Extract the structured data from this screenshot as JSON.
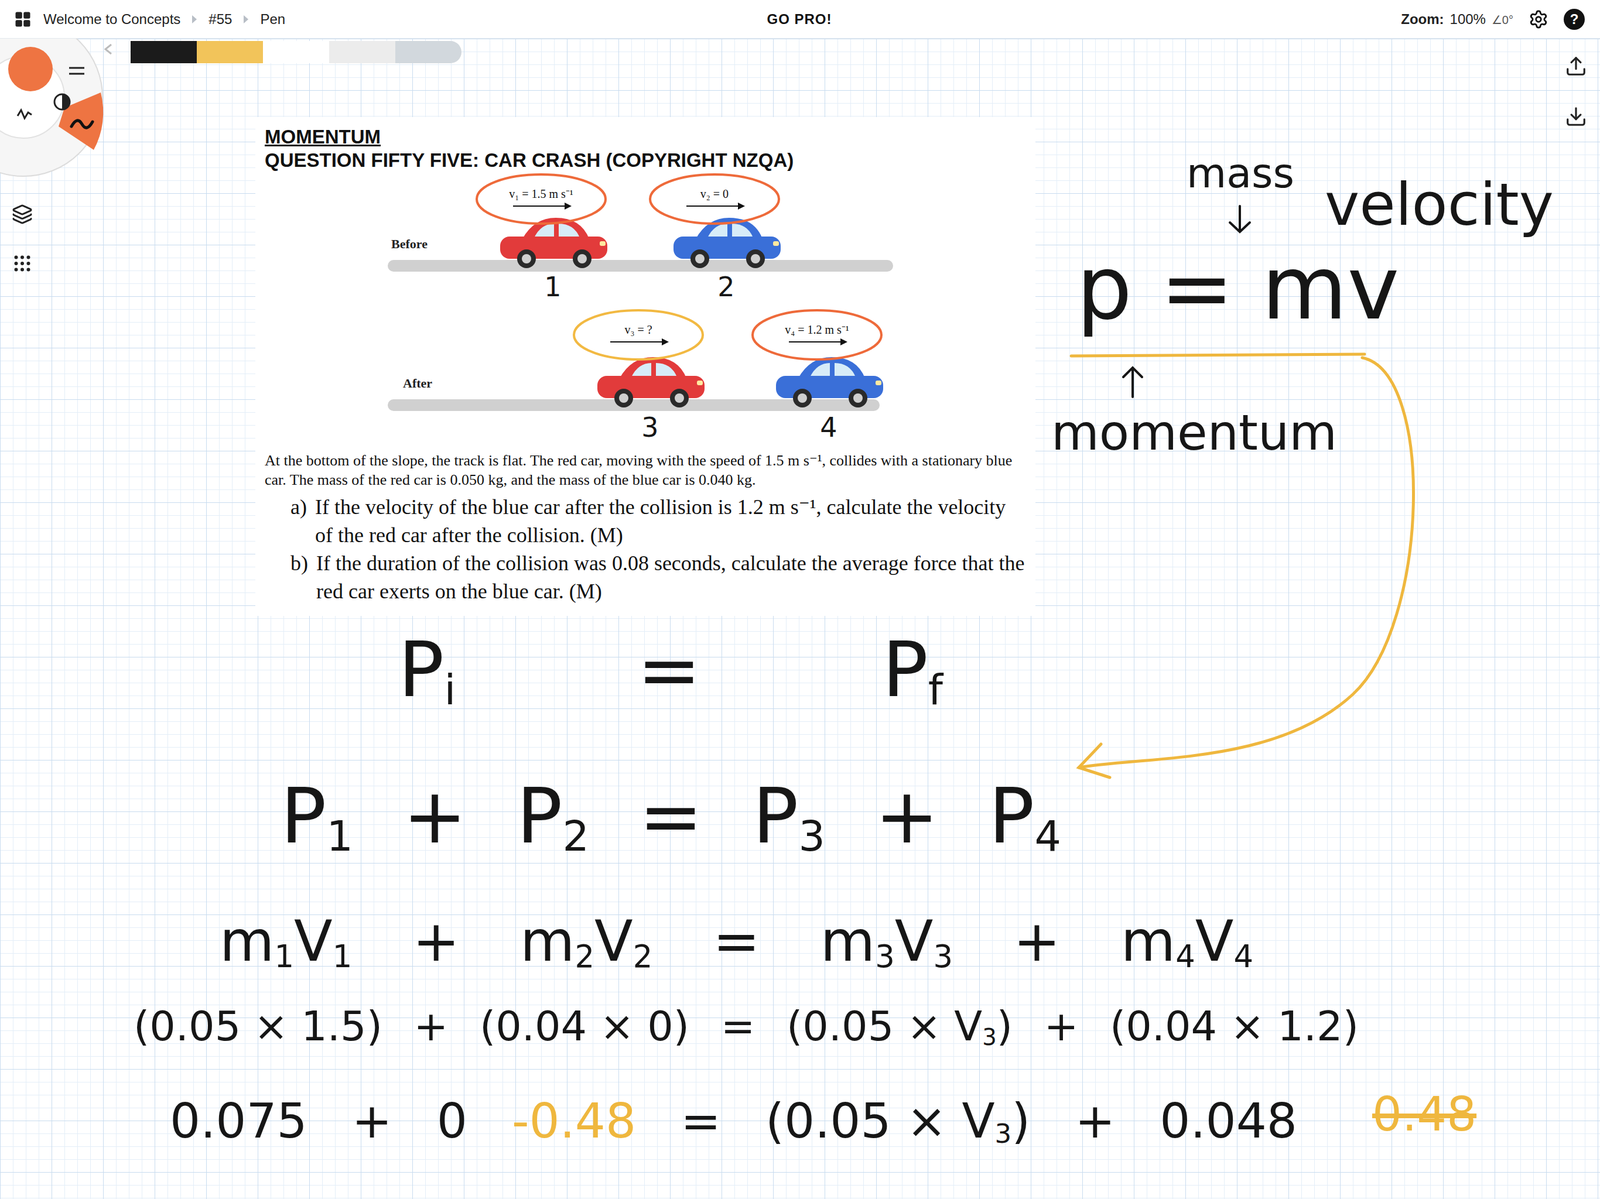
{
  "app_bar": {
    "breadcrumbs": [
      {
        "label": "Welcome to Concepts"
      },
      {
        "label": "#55"
      },
      {
        "label": "Pen"
      }
    ],
    "promo": "GO PRO!",
    "zoom_label": "Zoom:",
    "zoom_value": "100%",
    "rotation": "∠0°",
    "help": "?"
  },
  "toolbar": {
    "brush_color": "#ee7442",
    "swatches": [
      {
        "color": "#1b1b1b"
      },
      {
        "color": "#f2c45a"
      },
      {
        "color": "#ffffff"
      },
      {
        "color": "#ececec"
      },
      {
        "color": "#d2d8dd"
      }
    ]
  },
  "document": {
    "title": "MOMENTUM",
    "subtitle": "QUESTION FIFTY FIVE: CAR CRASH (COPYRIGHT NZQA)",
    "rows": [
      {
        "label": "Before"
      },
      {
        "label": "After"
      }
    ],
    "cars": [
      {
        "velocity": "v₁ = 1.5 m s⁻¹",
        "number": "1",
        "color": "#e23b3b",
        "ring_color": "#ee6a3a",
        "row": "Before"
      },
      {
        "velocity": "v₂ = 0",
        "number": "2",
        "color": "#3a6fd8",
        "ring_color": "#ee6a3a",
        "row": "Before"
      },
      {
        "velocity": "v₃ = ?",
        "number": "3",
        "color": "#e23b3b",
        "ring_color": "#f2b942",
        "row": "After"
      },
      {
        "velocity": "v₄ = 1.2 m s⁻¹",
        "number": "4",
        "color": "#3a6fd8",
        "ring_color": "#ee6a3a",
        "row": "After"
      }
    ],
    "paragraph": "At the bottom of the slope, the track is flat. The red car, moving with the speed of 1.5 m s⁻¹, collides with a stationary blue car. The mass of the red car is 0.050 kg, and the mass of the blue car is 0.040 kg.",
    "questions": [
      {
        "marker": "a)",
        "text": "If the velocity of the blue car after the collision is 1.2 m s⁻¹, calculate the velocity of the red car after the collision. (M)"
      },
      {
        "marker": "b)",
        "text": "If the duration of the collision was 0.08 seconds, calculate the average force that the red car exerts on the blue car. (M)"
      }
    ]
  },
  "notes": {
    "formula": {
      "text": "p = mv",
      "labels": [
        {
          "text": "mass"
        },
        {
          "text": "velocity"
        },
        {
          "text": "momentum"
        }
      ]
    },
    "equations": [
      {
        "terms": [
          {
            "segments": [
              {
                "text": "P",
                "sub": "i"
              }
            ],
            "color": "#161616"
          },
          {
            "segments": [
              {
                "text": "=",
                "sub": ""
              }
            ],
            "color": "#161616"
          },
          {
            "segments": [
              {
                "text": "P",
                "sub": "f"
              }
            ],
            "color": "#161616"
          }
        ]
      },
      {
        "terms": [
          {
            "segments": [
              {
                "text": "P",
                "sub": "1"
              }
            ],
            "color": "#161616"
          },
          {
            "segments": [
              {
                "text": "+",
                "sub": ""
              }
            ],
            "color": "#161616"
          },
          {
            "segments": [
              {
                "text": "P",
                "sub": "2"
              }
            ],
            "color": "#161616"
          },
          {
            "segments": [
              {
                "text": "=",
                "sub": ""
              }
            ],
            "color": "#161616"
          },
          {
            "segments": [
              {
                "text": "P",
                "sub": "3"
              }
            ],
            "color": "#161616"
          },
          {
            "segments": [
              {
                "text": "+",
                "sub": ""
              }
            ],
            "color": "#161616"
          },
          {
            "segments": [
              {
                "text": "P",
                "sub": "4"
              }
            ],
            "color": "#161616"
          }
        ]
      },
      {
        "terms": [
          {
            "segments": [
              {
                "text": "m",
                "sub": "1"
              },
              {
                "text": "V",
                "sub": "1"
              }
            ],
            "color": "#161616"
          },
          {
            "segments": [
              {
                "text": "+",
                "sub": ""
              }
            ],
            "color": "#161616"
          },
          {
            "segments": [
              {
                "text": "m",
                "sub": "2"
              },
              {
                "text": "V",
                "sub": "2"
              }
            ],
            "color": "#161616"
          },
          {
            "segments": [
              {
                "text": "=",
                "sub": ""
              }
            ],
            "color": "#161616"
          },
          {
            "segments": [
              {
                "text": "m",
                "sub": "3"
              },
              {
                "text": "V",
                "sub": "3"
              }
            ],
            "color": "#161616"
          },
          {
            "segments": [
              {
                "text": "+",
                "sub": ""
              }
            ],
            "color": "#161616"
          },
          {
            "segments": [
              {
                "text": "m",
                "sub": "4"
              },
              {
                "text": "V",
                "sub": "4"
              }
            ],
            "color": "#161616"
          }
        ]
      },
      {
        "terms": [
          {
            "segments": [
              {
                "text": "(0.05 × 1.5)",
                "sub": ""
              }
            ],
            "color": "#161616"
          },
          {
            "segments": [
              {
                "text": "+",
                "sub": ""
              }
            ],
            "color": "#161616"
          },
          {
            "segments": [
              {
                "text": "(0.04 × 0)",
                "sub": ""
              }
            ],
            "color": "#161616"
          },
          {
            "segments": [
              {
                "text": "=",
                "sub": ""
              }
            ],
            "color": "#161616"
          },
          {
            "segments": [
              {
                "text": "(0.05 × V",
                "sub": "3"
              },
              {
                "text": ")",
                "sub": ""
              }
            ],
            "color": "#161616"
          },
          {
            "segments": [
              {
                "text": "+",
                "sub": ""
              }
            ],
            "color": "#161616"
          },
          {
            "segments": [
              {
                "text": "(0.04 × 1.2)",
                "sub": ""
              }
            ],
            "color": "#161616"
          }
        ]
      },
      {
        "terms": [
          {
            "segments": [
              {
                "text": "0.075",
                "sub": ""
              }
            ],
            "color": "#161616"
          },
          {
            "segments": [
              {
                "text": "+",
                "sub": ""
              }
            ],
            "color": "#161616"
          },
          {
            "segments": [
              {
                "text": "0",
                "sub": ""
              }
            ],
            "color": "#161616"
          },
          {
            "segments": [
              {
                "text": "-0.48",
                "sub": ""
              }
            ],
            "color": "#efb73e"
          },
          {
            "segments": [
              {
                "text": "=",
                "sub": ""
              }
            ],
            "color": "#161616"
          },
          {
            "segments": [
              {
                "text": "(0.05 × V",
                "sub": "3"
              },
              {
                "text": ")",
                "sub": ""
              }
            ],
            "color": "#161616"
          },
          {
            "segments": [
              {
                "text": "+",
                "sub": ""
              }
            ],
            "color": "#161616"
          },
          {
            "segments": [
              {
                "text": "0.048",
                "sub": ""
              }
            ],
            "color": "#161616"
          }
        ]
      }
    ],
    "side_notes": [
      {
        "text": "0.48",
        "color": "#efb73e",
        "struck": true
      }
    ]
  }
}
